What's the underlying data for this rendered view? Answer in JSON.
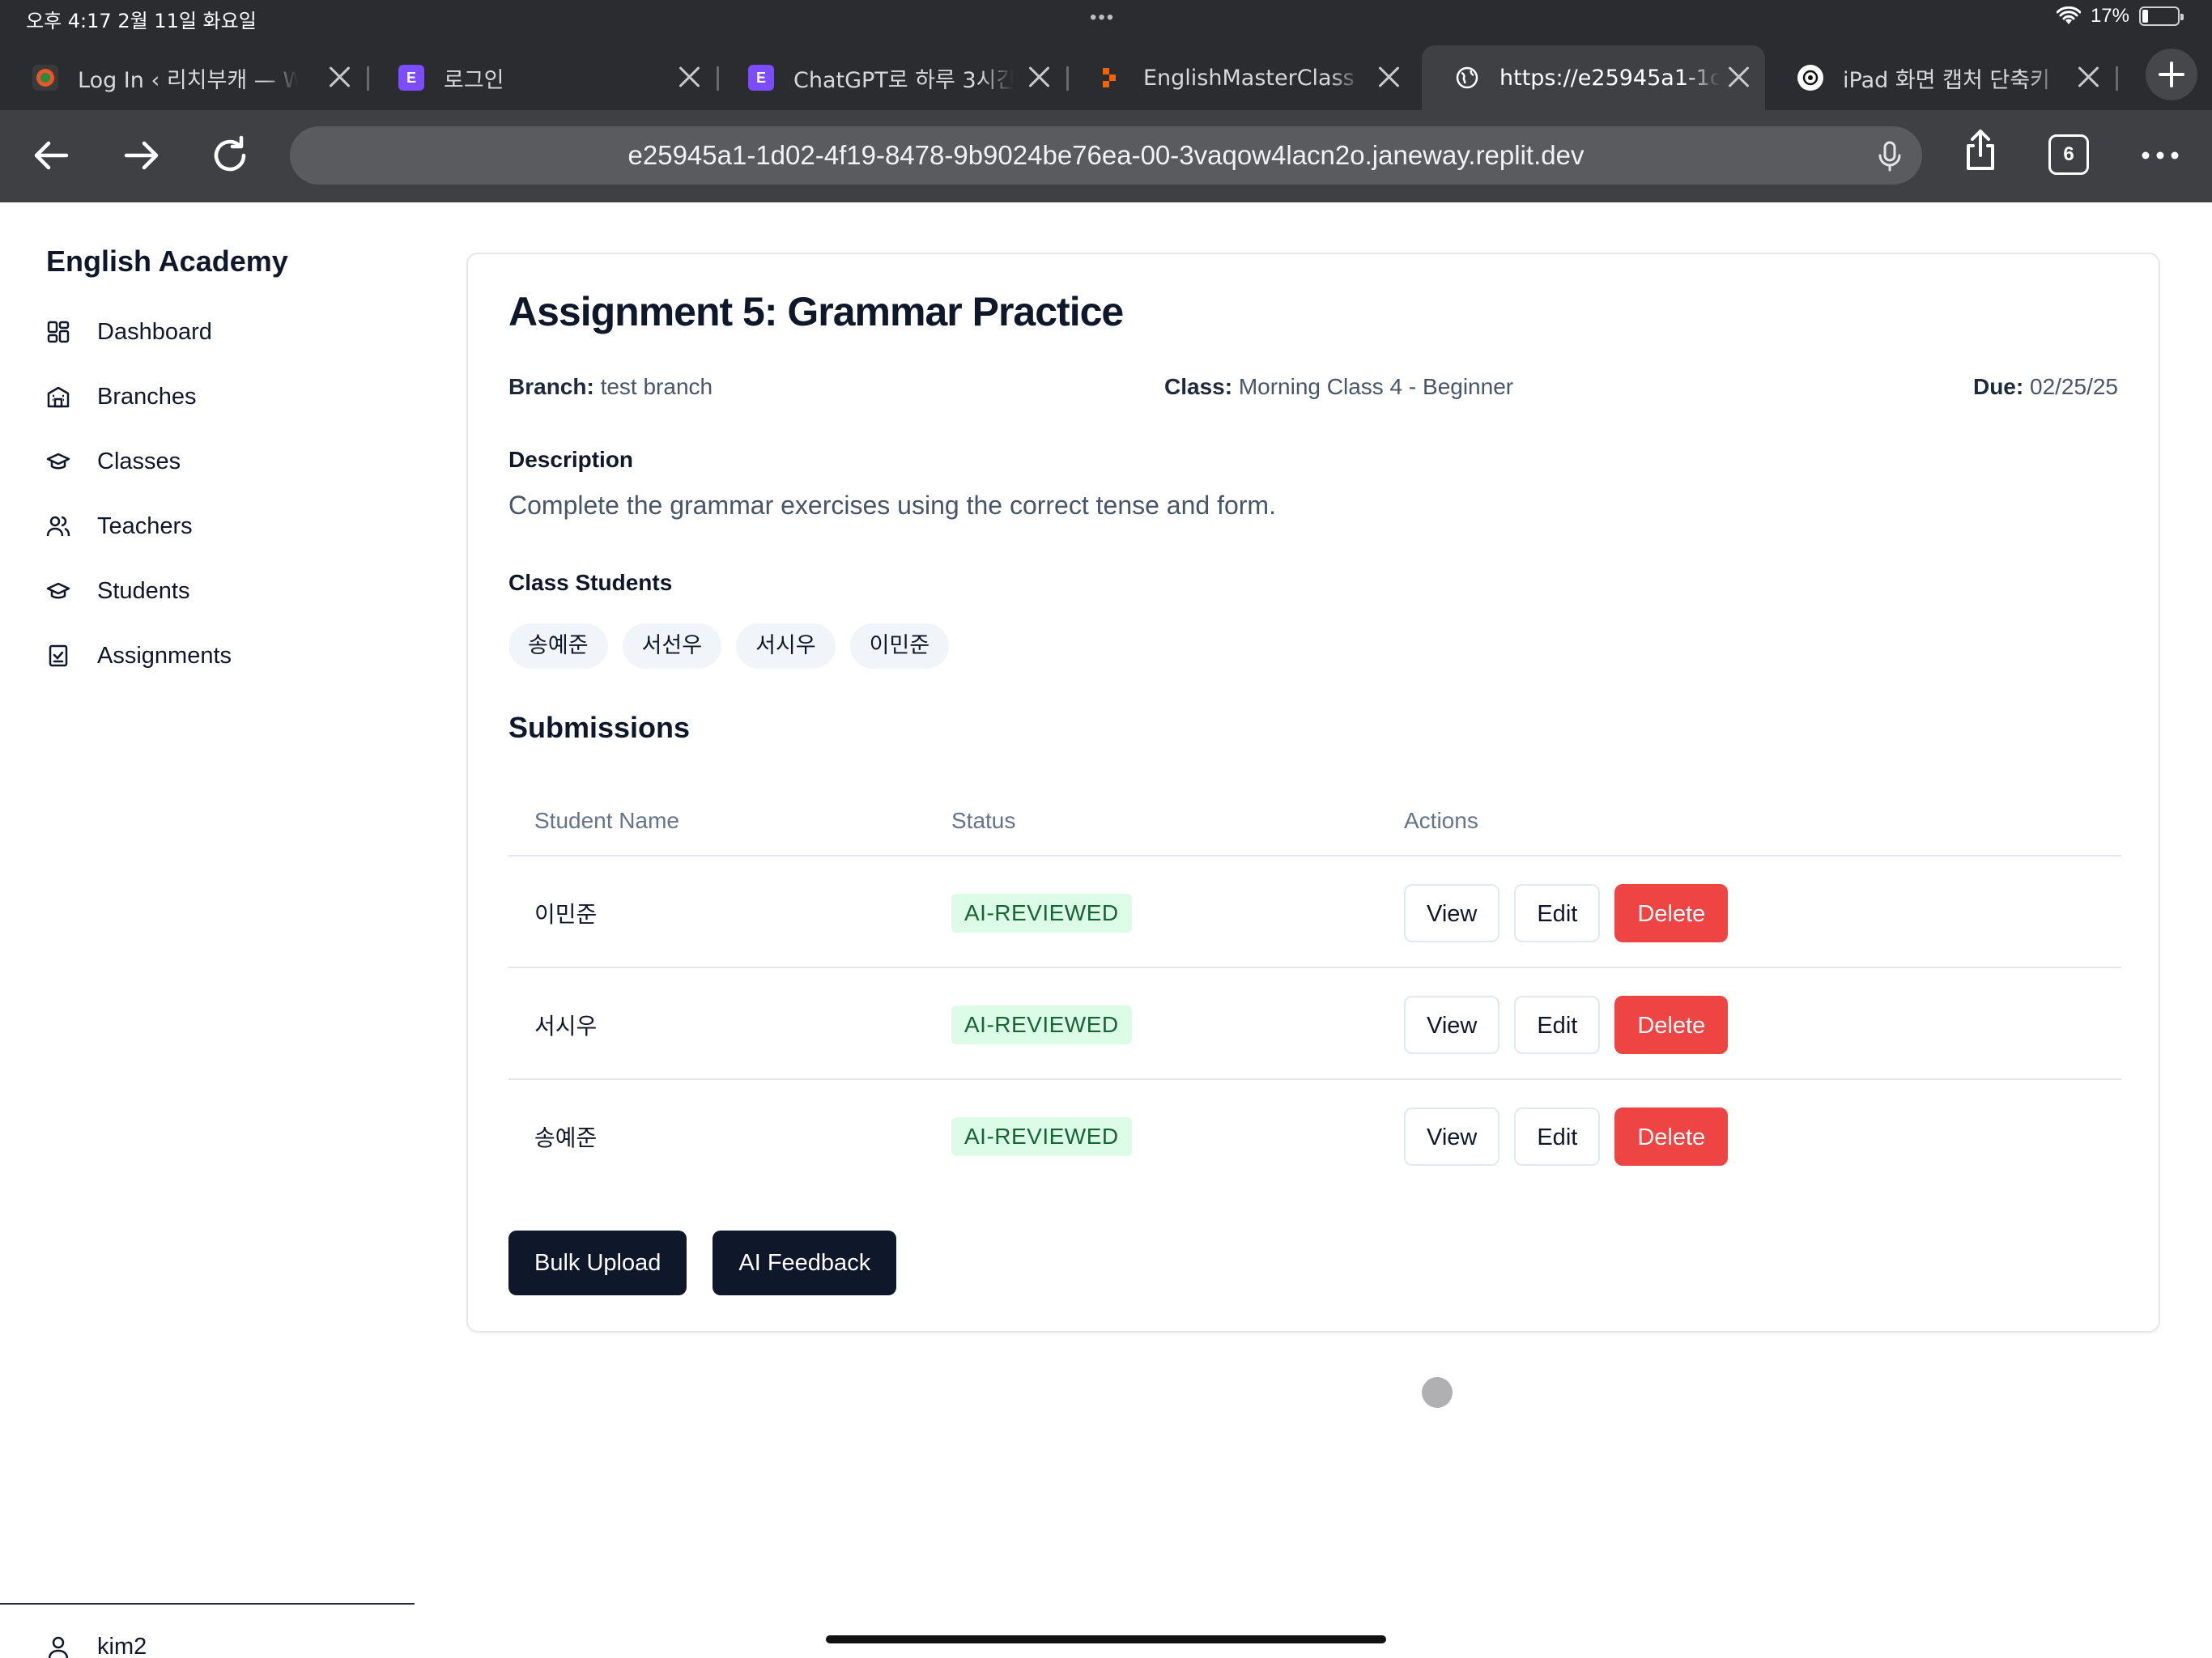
{
  "status_bar": {
    "time": "오후 4:17",
    "date": "2월 11일 화요일",
    "battery": "17%",
    "battery_level": 0.17
  },
  "tabs": [
    {
      "title": "Log In ‹ 리치부캐 — W",
      "favicon_color": "#e8562a",
      "active": false
    },
    {
      "title": "로그인",
      "favicon_color": "#7c4dff",
      "active": false
    },
    {
      "title": "ChatGPT로 하루 3시간",
      "favicon_color": "#7c4dff",
      "active": false
    },
    {
      "title": "EnglishMasterClass",
      "favicon_color": "#f26207",
      "active": false
    },
    {
      "title": "https://e25945a1-1d",
      "favicon_color": "#3f4044",
      "active": true
    },
    {
      "title": "iPad 화면 캡처 단축키",
      "favicon_color": "#2b2c30",
      "active": false
    }
  ],
  "toolbar": {
    "url": "e25945a1-1d02-4f19-8478-9b9024be76ea-00-3vaqow4lacn2o.janeway.replit.dev",
    "tab_count": "6"
  },
  "sidebar": {
    "brand": "English Academy",
    "items": [
      {
        "label": "Dashboard",
        "icon": "dashboard-icon"
      },
      {
        "label": "Branches",
        "icon": "building-icon"
      },
      {
        "label": "Classes",
        "icon": "graduation-cap-icon"
      },
      {
        "label": "Teachers",
        "icon": "users-icon"
      },
      {
        "label": "Students",
        "icon": "graduation-cap-icon"
      },
      {
        "label": "Assignments",
        "icon": "clipboard-check-icon"
      }
    ],
    "user": "kim2"
  },
  "assignment": {
    "title": "Assignment 5: Grammar Practice",
    "branch_label": "Branch:",
    "branch": "test branch",
    "class_label": "Class:",
    "class": "Morning Class 4 - Beginner",
    "due_label": "Due:",
    "due": "02/25/25",
    "description_label": "Description",
    "description": "Complete the grammar exercises using the correct tense and form.",
    "students_label": "Class Students",
    "students": [
      "송예준",
      "서선우",
      "서시우",
      "이민준"
    ]
  },
  "submissions": {
    "title": "Submissions",
    "columns": [
      "Student Name",
      "Status",
      "Actions"
    ],
    "rows": [
      {
        "name": "이민준",
        "status": "AI-REVIEWED"
      },
      {
        "name": "서시우",
        "status": "AI-REVIEWED"
      },
      {
        "name": "송예준",
        "status": "AI-REVIEWED"
      }
    ],
    "view_label": "View",
    "edit_label": "Edit",
    "delete_label": "Delete"
  },
  "footer": {
    "bulk_upload": "Bulk Upload",
    "ai_feedback": "AI Feedback"
  },
  "colors": {
    "danger": "#ef4444",
    "primary_dark": "#0f172a",
    "badge_bg": "#dcfce7",
    "badge_text": "#166534"
  }
}
